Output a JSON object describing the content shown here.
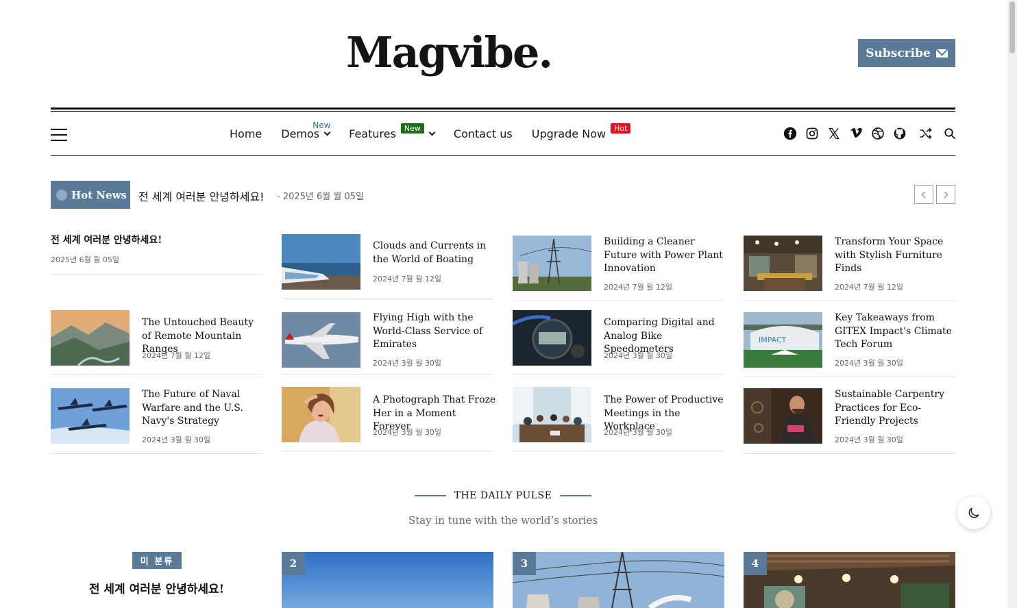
{
  "header": {
    "logo": "Magvibe.",
    "subscribe_label": "Subscribe"
  },
  "nav": {
    "items": [
      {
        "label": "Home"
      },
      {
        "label": "Demos",
        "sup": "New"
      },
      {
        "label": "Features",
        "badge": "New"
      },
      {
        "label": "Contact us"
      },
      {
        "label": "Upgrade Now",
        "badge": "Hot"
      }
    ],
    "social_icons": [
      "facebook-icon",
      "instagram-icon",
      "x-icon",
      "vimeo-icon",
      "dribbble-icon",
      "github-icon",
      "shuffle-icon"
    ]
  },
  "ticker": {
    "label": "Hot News",
    "headline": "전 세계 여러분 안녕하세요!",
    "date": "- 2025년 6월 월 05일"
  },
  "articles": [
    {
      "title": "전 세계 여러분 안녕하세요!",
      "date": "2025년 6월 월 05일"
    },
    {
      "title": "Clouds and Currents in the World of Boating",
      "date": "2024년 7월 월 12일"
    },
    {
      "title": "Building a Cleaner Future with Power Plant Innovation",
      "date": "2024년 7월 월 12일"
    },
    {
      "title": "Transform Your Space with Stylish Furniture Finds",
      "date": "2024년 7월 월 12일"
    },
    {
      "title": "The Untouched Beauty of Remote Mountain Ranges",
      "date": "2024년 7월 월 12일"
    },
    {
      "title": "Flying High with the World-Class Service of Emirates",
      "date": "2024년 3월 월 30일"
    },
    {
      "title": "Comparing Digital and Analog Bike Speedometers",
      "date": "2024년 3월 월 30일"
    },
    {
      "title": "Key Takeaways from GITEX Impact's Climate Tech Forum",
      "date": "2024년 3월 월 30일"
    },
    {
      "title": "The Future of Naval Warfare and the U.S. Navy's Strategy",
      "date": "2024년 3월 월 30일"
    },
    {
      "title": "A Photograph That Froze Her in a Moment Forever",
      "date": "2024년 3월 월 30일"
    },
    {
      "title": "The Power of Productive Meetings in the Workplace",
      "date": "2024년 3월 월 30일"
    },
    {
      "title": "Sustainable Carpentry Practices for Eco-Friendly Projects",
      "date": "2024년 3월 월 30일"
    }
  ],
  "section": {
    "title": "THE DAILY PULSE",
    "subtitle": "Stay in tune with the world’s stories",
    "category": "미 분류",
    "first_title": "전 세계 여러분 안녕하세요!",
    "numbers": [
      "2",
      "3",
      "4"
    ]
  },
  "colors": {
    "accent": "#5a7a99",
    "badge_green": "#1e6b1a",
    "badge_red": "#e0141e"
  }
}
